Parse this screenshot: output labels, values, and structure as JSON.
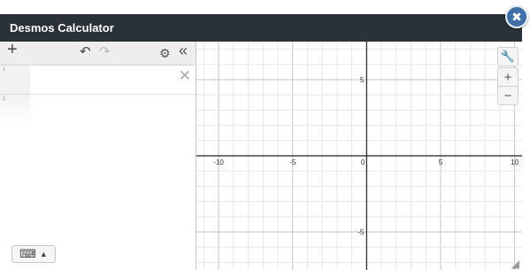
{
  "window": {
    "title": "Desmos Calculator",
    "close_glyph": "✖"
  },
  "toolbar": {
    "add_glyph": "+",
    "undo_glyph": "↶",
    "redo_glyph": "↷",
    "settings_glyph": "⚙",
    "collapse_glyph": "«"
  },
  "expressions": [
    {
      "index": "1",
      "value": "",
      "delete_glyph": "✕"
    },
    {
      "index": "2",
      "value": ""
    }
  ],
  "keyboard": {
    "icon": "keyboard-icon",
    "toggle_glyph": "▲",
    "keys_glyph": "⌨"
  },
  "graph_controls": {
    "wrench_glyph": "🔧",
    "zoom_in": "+",
    "zoom_out": "−"
  },
  "axes": {
    "x_range": [
      -11.5,
      10.5
    ],
    "y_range": [
      -7.5,
      7.5
    ],
    "x_tick_labels": [
      "-10",
      "-5",
      "0",
      "5",
      "10"
    ],
    "y_tick_labels": [
      "5",
      "-5"
    ],
    "minor_grid_step": 1,
    "major_grid_step": 5
  },
  "colors": {
    "titlebar": "#2a3139",
    "close_button": "#3f6ea8",
    "minor_grid": "#e8e8e8",
    "major_grid": "#c4c4c4",
    "axis": "#222222"
  },
  "resize_glyph": "◢"
}
